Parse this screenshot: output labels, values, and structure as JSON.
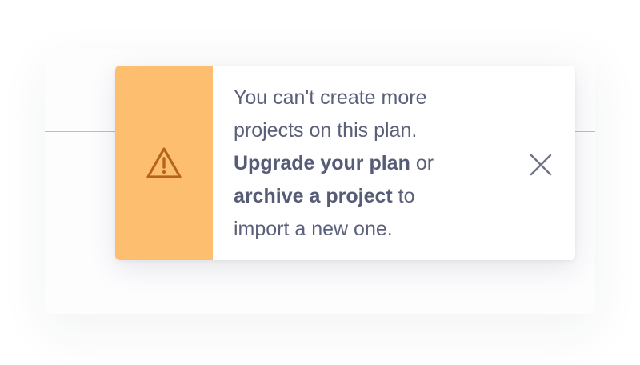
{
  "colors": {
    "accent": "#fdbe6f",
    "warning_icon": "#b6641c",
    "text": "#5b607a",
    "close_icon": "#6e7286",
    "divider": "#b9bdd2"
  },
  "background": {
    "ghost_buttons": [
      {
        "icon": "user-plus-icon"
      },
      {
        "icon": "gear-icon"
      }
    ]
  },
  "toast": {
    "icon": "warning-icon",
    "message": {
      "line1": "You can't create more projects on this plan.",
      "upgrade_link": "Upgrade your plan",
      "or_text": "or",
      "archive_link": "archive a project",
      "suffix": "to import a new one."
    },
    "close_icon": "close-icon"
  }
}
